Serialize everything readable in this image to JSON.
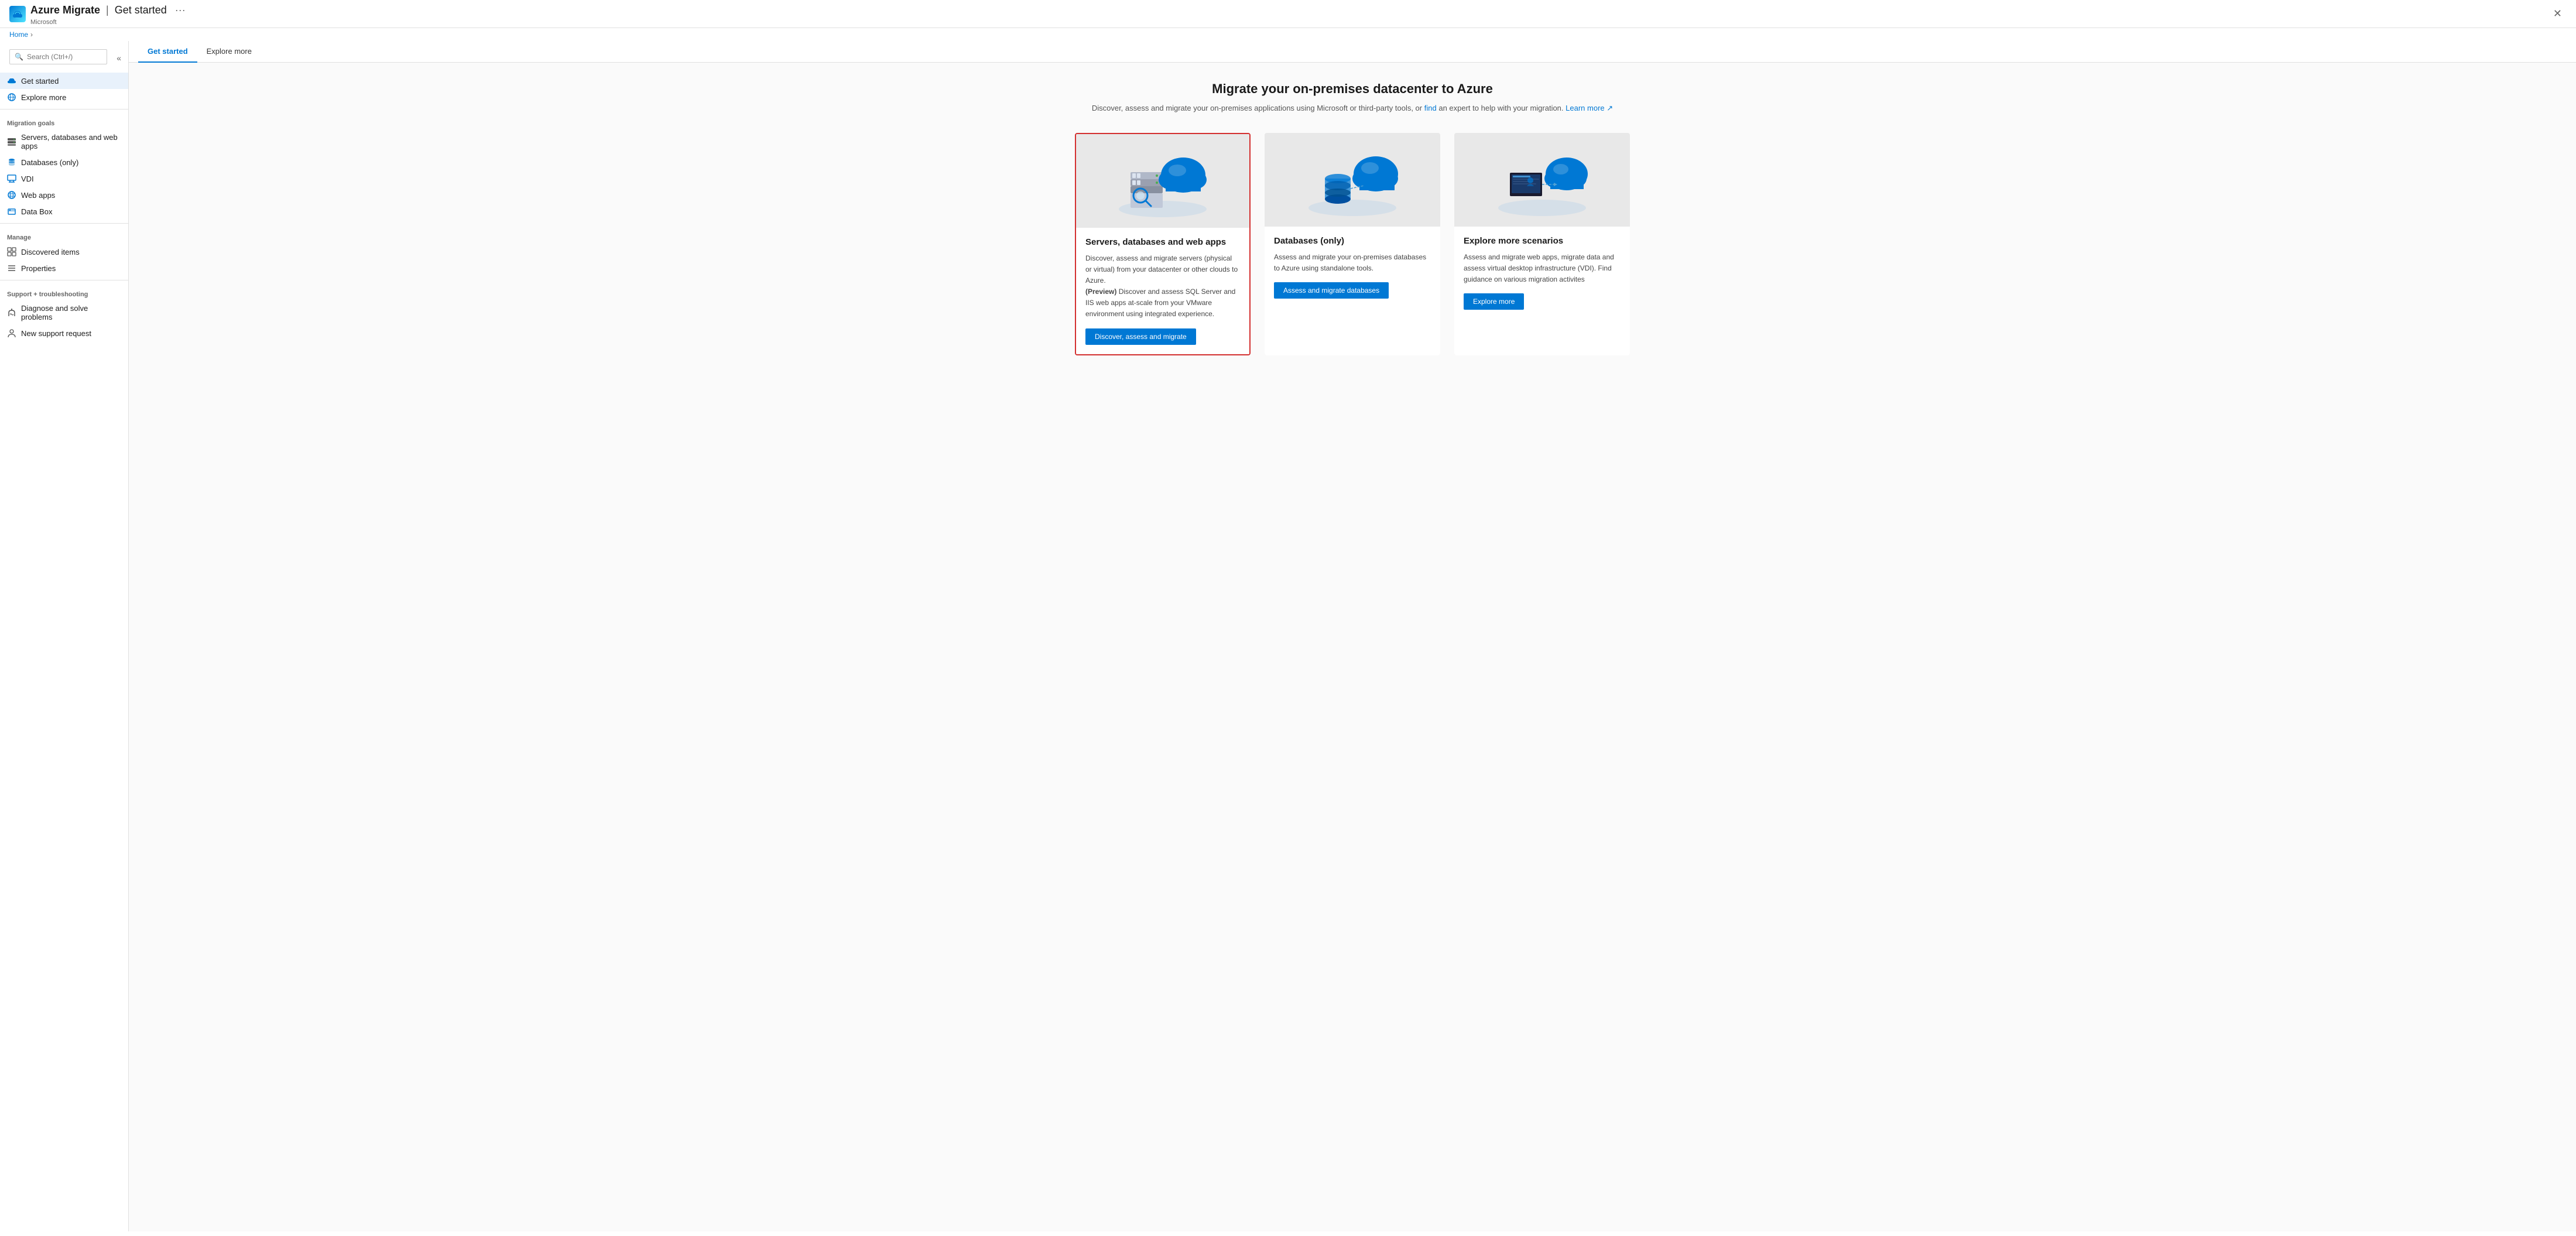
{
  "app": {
    "icon": "☁",
    "title": "Azure Migrate",
    "separator": "|",
    "subtitle": "Get started",
    "provider": "Microsoft",
    "close_label": "✕",
    "more_label": "···"
  },
  "breadcrumb": {
    "home": "Home",
    "separator": "›"
  },
  "search": {
    "placeholder": "Search (Ctrl+/)"
  },
  "sidebar": {
    "collapse_icon": "«",
    "nav_items": [
      {
        "id": "get-started",
        "label": "Get started",
        "icon": "cloud",
        "active": true
      },
      {
        "id": "explore-more",
        "label": "Explore more",
        "icon": "globe"
      }
    ],
    "sections": [
      {
        "title": "Migration goals",
        "items": [
          {
            "id": "servers-databases-webapps",
            "label": "Servers, databases and web apps",
            "icon": "servers"
          },
          {
            "id": "databases-only",
            "label": "Databases (only)",
            "icon": "db"
          },
          {
            "id": "vdi",
            "label": "VDI",
            "icon": "vdi"
          },
          {
            "id": "web-apps",
            "label": "Web apps",
            "icon": "webapps"
          },
          {
            "id": "data-box",
            "label": "Data Box",
            "icon": "databox"
          }
        ]
      },
      {
        "title": "Manage",
        "items": [
          {
            "id": "discovered-items",
            "label": "Discovered items",
            "icon": "grid"
          },
          {
            "id": "properties",
            "label": "Properties",
            "icon": "bars"
          }
        ]
      },
      {
        "title": "Support + troubleshooting",
        "items": [
          {
            "id": "diagnose",
            "label": "Diagnose and solve problems",
            "icon": "wrench"
          },
          {
            "id": "support-request",
            "label": "New support request",
            "icon": "person"
          }
        ]
      }
    ]
  },
  "tabs": [
    {
      "id": "get-started",
      "label": "Get started",
      "active": true
    },
    {
      "id": "explore-more",
      "label": "Explore more",
      "active": false
    }
  ],
  "main": {
    "heading": "Migrate your on-premises datacenter to Azure",
    "subtext1": "Discover, assess and migrate your on-premises applications using Microsoft or third-party tools, or",
    "link1": "find",
    "subtext2": "an expert",
    "subtext3": "to help with your migration.",
    "link2": "Learn more",
    "cards": [
      {
        "id": "servers-db-webapps",
        "title": "Servers, databases and web apps",
        "desc_normal": "Discover, assess and migrate servers (physical or virtual) from your datacenter or other clouds to Azure.",
        "desc_bold_label": "(Preview)",
        "desc_bold_text": " Discover and assess SQL Server and IIS web apps at-scale from your VMware environment using integrated experience.",
        "button_label": "Discover, assess and migrate",
        "selected": true
      },
      {
        "id": "databases-only",
        "title": "Databases (only)",
        "desc_normal": "Assess and migrate your on-premises databases to Azure using standalone tools.",
        "desc_bold_label": "",
        "desc_bold_text": "",
        "button_label": "Assess and migrate databases",
        "selected": false
      },
      {
        "id": "explore-more-scenarios",
        "title": "Explore more scenarios",
        "desc_normal": "Assess and migrate web apps, migrate data and assess virtual desktop infrastructure (VDI). Find guidance on various migration activites",
        "desc_bold_label": "",
        "desc_bold_text": "",
        "button_label": "Explore more",
        "selected": false
      }
    ]
  }
}
